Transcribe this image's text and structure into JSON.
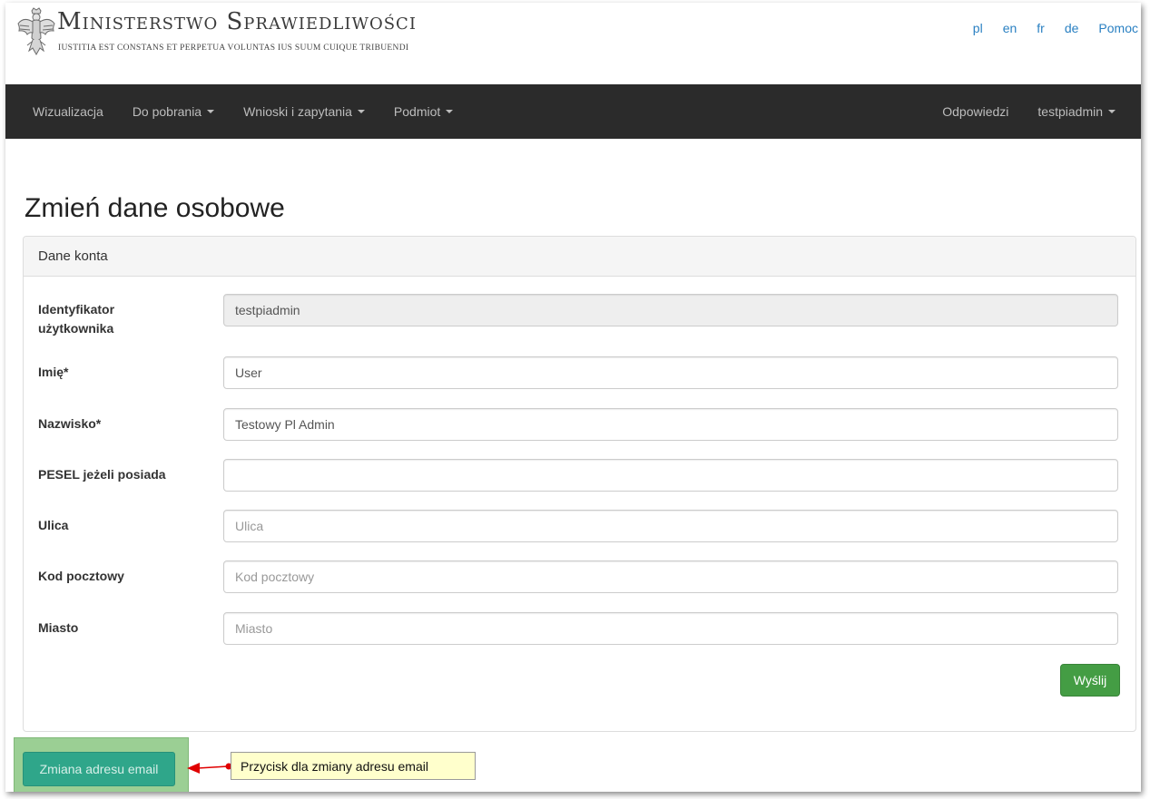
{
  "header": {
    "title": "Ministerstwo Sprawiedliwości",
    "motto": "IUSTITIA EST CONSTANS ET PERPETUA VOLUNTAS IUS SUUM CUIQUE TRIBUENDI",
    "languages": [
      "pl",
      "en",
      "fr",
      "de"
    ],
    "help": "Pomoc"
  },
  "navbar": {
    "left": [
      {
        "label": "Wizualizacja",
        "dropdown": false
      },
      {
        "label": "Do pobrania",
        "dropdown": true
      },
      {
        "label": "Wnioski i zapytania",
        "dropdown": true
      },
      {
        "label": "Podmiot",
        "dropdown": true
      }
    ],
    "right": [
      {
        "label": "Odpowiedzi",
        "dropdown": false
      },
      {
        "label": "testpiadmin",
        "dropdown": true
      }
    ]
  },
  "page": {
    "title": "Zmień dane osobowe",
    "panel_title": "Dane konta"
  },
  "form": {
    "fields": [
      {
        "label": "Identyfikator użytkownika",
        "value": "testpiadmin",
        "placeholder": "",
        "readonly": true
      },
      {
        "label": "Imię*",
        "value": "User",
        "placeholder": ""
      },
      {
        "label": "Nazwisko*",
        "value": "Testowy Pl Admin",
        "placeholder": ""
      },
      {
        "label": "PESEL jeżeli posiada",
        "value": "",
        "placeholder": ""
      },
      {
        "label": "Ulica",
        "value": "",
        "placeholder": "Ulica"
      },
      {
        "label": "Kod pocztowy",
        "value": "",
        "placeholder": "Kod pocztowy"
      },
      {
        "label": "Miasto",
        "value": "",
        "placeholder": "Miasto"
      }
    ],
    "submit_label": "Wyślij"
  },
  "email_change": {
    "button_label": "Zmiana adresu email",
    "callout": "Przycisk dla zmiany adresu email"
  },
  "colors": {
    "navbar_bg": "#2b2b2b",
    "link": "#2a80c2",
    "submit": "#449d44",
    "email_button": "#2fa68a",
    "callout_bg": "#ffffcc",
    "arrow": "#e00000"
  }
}
